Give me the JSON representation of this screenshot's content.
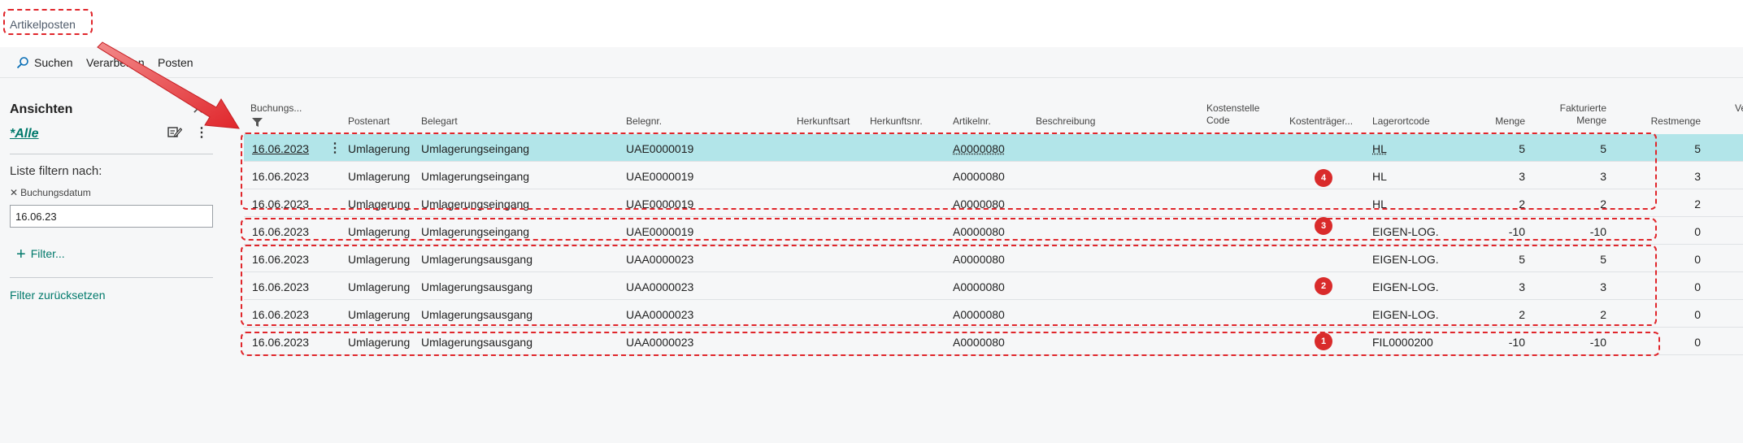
{
  "window": {
    "title": "Artikelposten"
  },
  "actions": [
    {
      "label": "Suchen",
      "icon": "search-icon"
    },
    {
      "label": "Verarbeiten"
    },
    {
      "label": "Posten"
    }
  ],
  "filter_pane": {
    "heading": "Ansichten",
    "view_name": "*Alle",
    "filter_list_title": "Liste filtern nach:",
    "field_label": "Buchungsdatum",
    "field_value": "16.06.23",
    "add_filter_label": "Filter...",
    "reset_label": "Filter zurücksetzen"
  },
  "grid": {
    "columns": {
      "buchungsdatum": "Buchungs...",
      "postenart": "Postenart",
      "belegart": "Belegart",
      "belegnr": "Belegnr.",
      "herkunftsart": "Herkunftsart",
      "herkunftsnr": "Herkunftsnr.",
      "artikelnr": "Artikelnr.",
      "beschreibung": "Beschreibung",
      "kostenstelle_1": "Kostenstelle",
      "kostenstelle_2": "Code",
      "kostentraeger": "Kostenträger...",
      "lagerortcode": "Lagerortcode",
      "menge": "Menge",
      "fakturierte_1": "Fakturierte",
      "fakturierte_2": "Menge",
      "restmenge": "Restmenge",
      "cut_off": "Ve"
    },
    "rows": [
      {
        "date": "16.06.2023",
        "postenart": "Umlagerung",
        "belegart": "Umlagerungseingang",
        "belegnr": "UAE0000019",
        "artikelnr": "A0000080",
        "lagerort": "HL",
        "menge": "5",
        "fakt": "5",
        "rest": "5"
      },
      {
        "date": "16.06.2023",
        "postenart": "Umlagerung",
        "belegart": "Umlagerungseingang",
        "belegnr": "UAE0000019",
        "artikelnr": "A0000080",
        "lagerort": "HL",
        "menge": "3",
        "fakt": "3",
        "rest": "3"
      },
      {
        "date": "16.06.2023",
        "postenart": "Umlagerung",
        "belegart": "Umlagerungseingang",
        "belegnr": "UAE0000019",
        "artikelnr": "A0000080",
        "lagerort": "HL",
        "menge": "2",
        "fakt": "2",
        "rest": "2"
      },
      {
        "date": "16.06.2023",
        "postenart": "Umlagerung",
        "belegart": "Umlagerungseingang",
        "belegnr": "UAE0000019",
        "artikelnr": "A0000080",
        "lagerort": "EIGEN-LOG.",
        "menge": "-10",
        "fakt": "-10",
        "rest": "0"
      },
      {
        "date": "16.06.2023",
        "postenart": "Umlagerung",
        "belegart": "Umlagerungsausgang",
        "belegnr": "UAA0000023",
        "artikelnr": "A0000080",
        "lagerort": "EIGEN-LOG.",
        "menge": "5",
        "fakt": "5",
        "rest": "0"
      },
      {
        "date": "16.06.2023",
        "postenart": "Umlagerung",
        "belegart": "Umlagerungsausgang",
        "belegnr": "UAA0000023",
        "artikelnr": "A0000080",
        "lagerort": "EIGEN-LOG.",
        "menge": "3",
        "fakt": "3",
        "rest": "0"
      },
      {
        "date": "16.06.2023",
        "postenart": "Umlagerung",
        "belegart": "Umlagerungsausgang",
        "belegnr": "UAA0000023",
        "artikelnr": "A0000080",
        "lagerort": "EIGEN-LOG.",
        "menge": "2",
        "fakt": "2",
        "rest": "0"
      },
      {
        "date": "16.06.2023",
        "postenart": "Umlagerung",
        "belegart": "Umlagerungsausgang",
        "belegnr": "UAA0000023",
        "artikelnr": "A0000080",
        "lagerort": "FIL0000200",
        "menge": "-10",
        "fakt": "-10",
        "rest": "0"
      }
    ]
  },
  "annotations": {
    "badges": [
      "4",
      "3",
      "2",
      "1"
    ],
    "color": "#e0262b"
  },
  "colors": {
    "accent": "#00796b",
    "selected_row": "#b2e5e9",
    "annotation_red": "#e0262b"
  }
}
